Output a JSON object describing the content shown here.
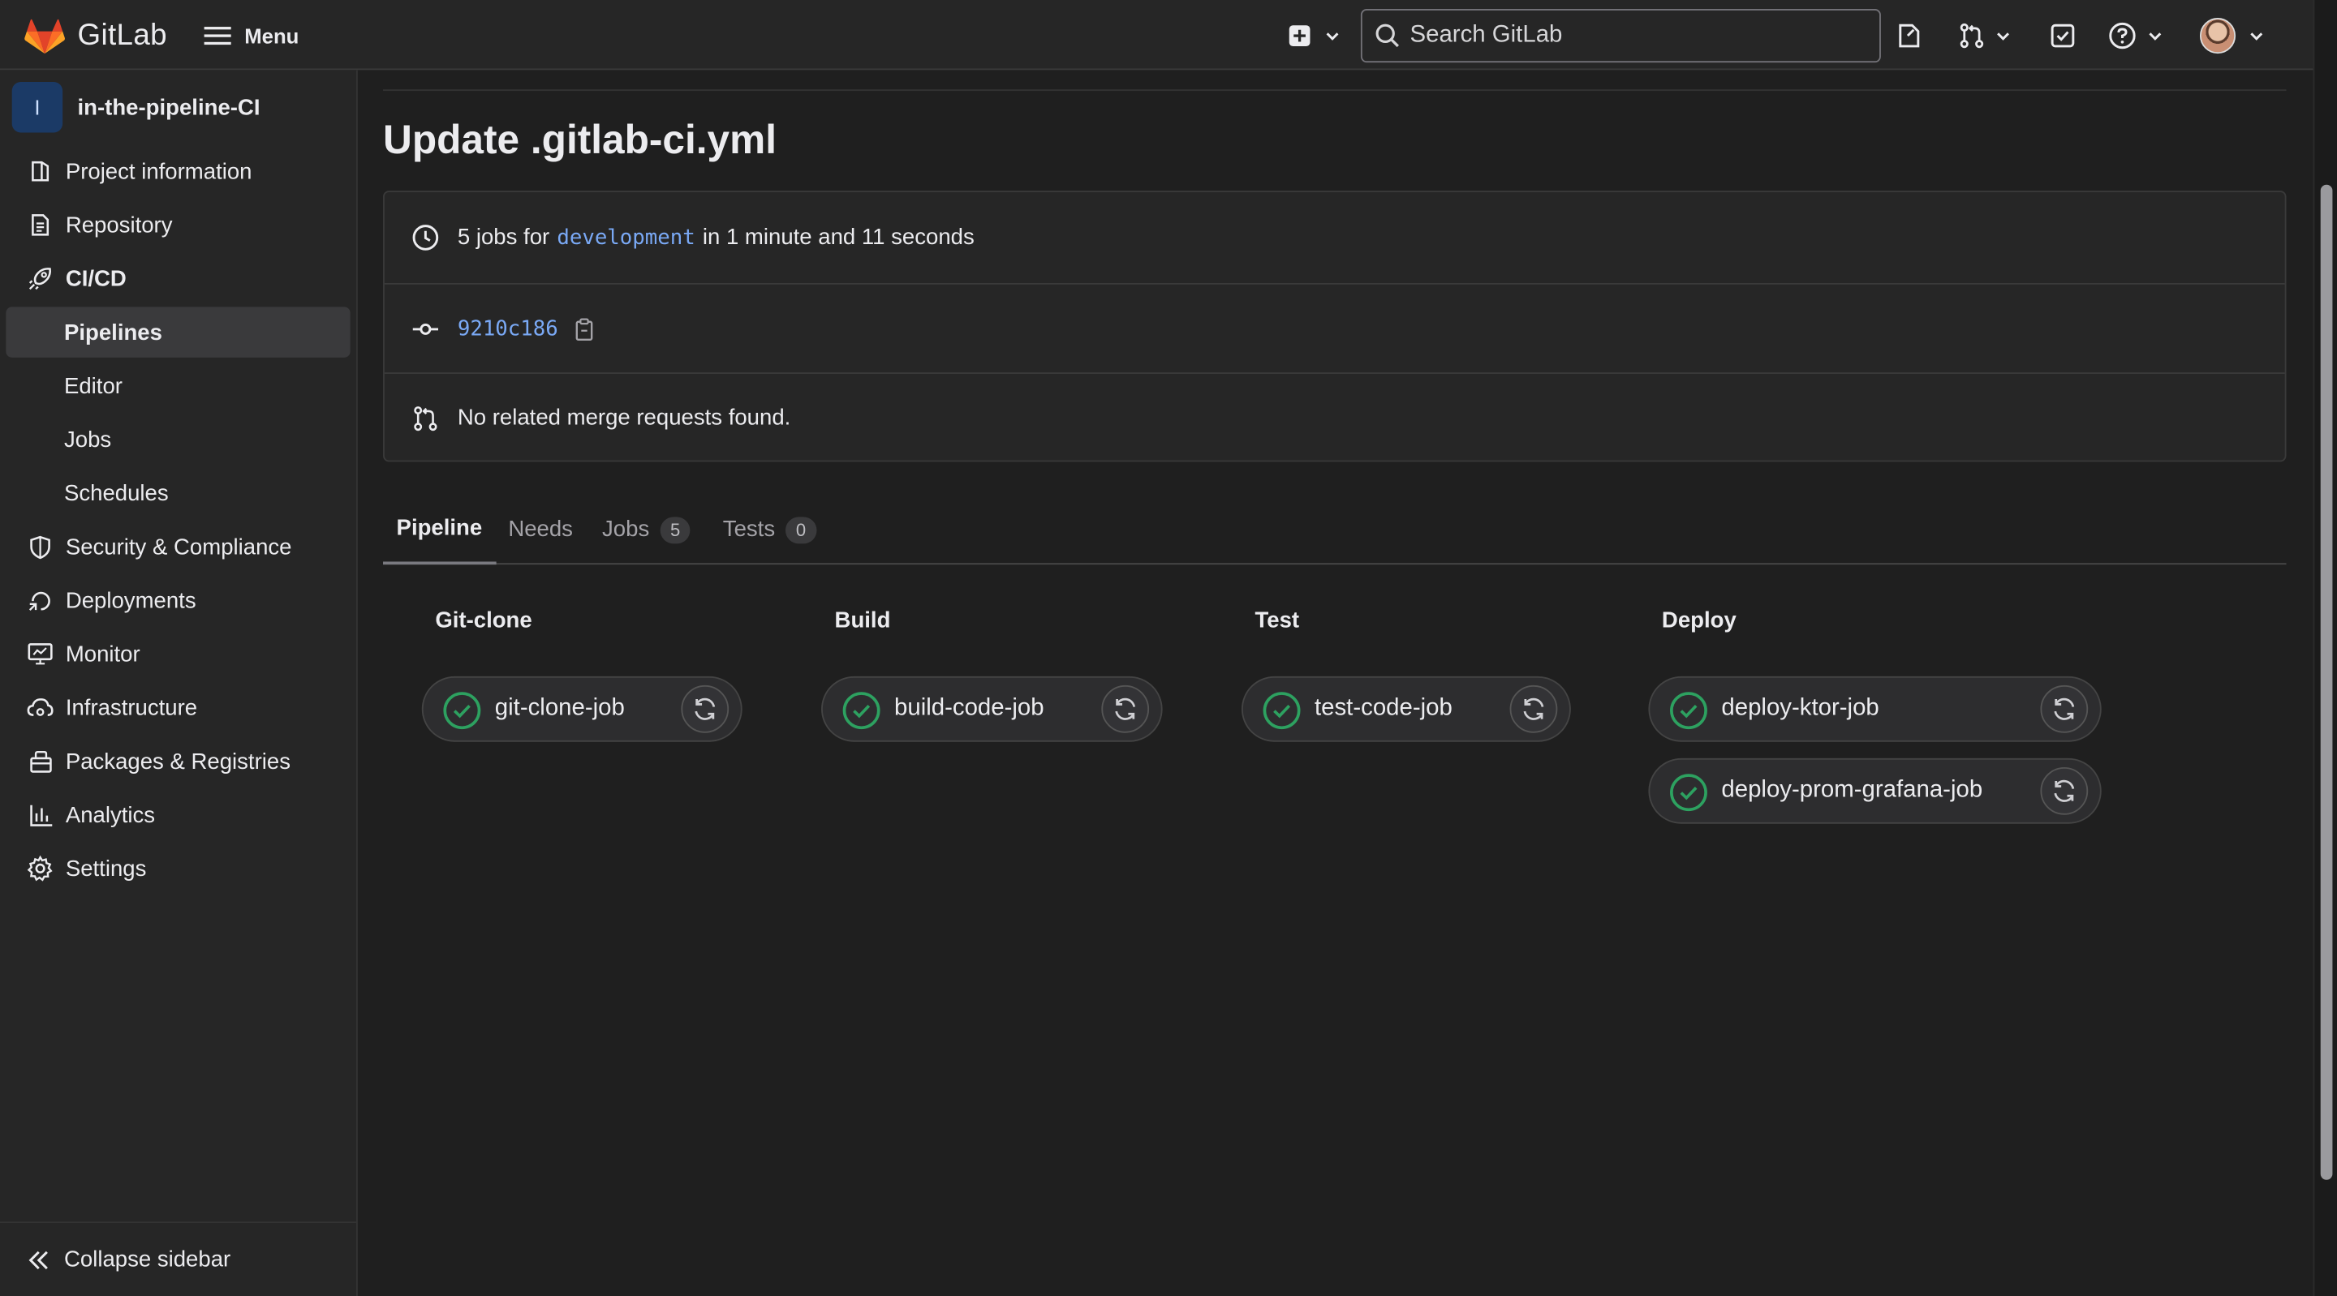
{
  "topbar": {
    "brand": "GitLab",
    "menu_label": "Menu",
    "search_placeholder": "Search GitLab"
  },
  "sidebar": {
    "project_initial": "I",
    "project_name": "in-the-pipeline-CI",
    "items": [
      {
        "label": "Project information",
        "icon": "project-info-icon"
      },
      {
        "label": "Repository",
        "icon": "repository-icon"
      },
      {
        "label": "CI/CD",
        "icon": "rocket-icon"
      },
      {
        "label": "Pipelines"
      },
      {
        "label": "Editor"
      },
      {
        "label": "Jobs"
      },
      {
        "label": "Schedules"
      },
      {
        "label": "Security & Compliance",
        "icon": "shield-icon"
      },
      {
        "label": "Deployments",
        "icon": "deployments-icon"
      },
      {
        "label": "Monitor",
        "icon": "monitor-icon"
      },
      {
        "label": "Infrastructure",
        "icon": "cloud-gear-icon"
      },
      {
        "label": "Packages & Registries",
        "icon": "package-icon"
      },
      {
        "label": "Analytics",
        "icon": "analytics-icon"
      },
      {
        "label": "Settings",
        "icon": "gear-icon"
      }
    ],
    "collapse_label": "Collapse sidebar"
  },
  "page": {
    "title": "Update .gitlab-ci.yml",
    "jobs_prefix": "5 jobs for",
    "branch": "development",
    "duration": "in 1 minute and 11 seconds",
    "commit_sha": "9210c186",
    "merge_requests": "No related merge requests found."
  },
  "tabs": [
    {
      "label": "Pipeline"
    },
    {
      "label": "Needs"
    },
    {
      "label": "Jobs",
      "count": "5"
    },
    {
      "label": "Tests",
      "count": "0"
    }
  ],
  "stages": [
    {
      "name": "Git-clone",
      "jobs": [
        "git-clone-job"
      ]
    },
    {
      "name": "Build",
      "jobs": [
        "build-code-job"
      ]
    },
    {
      "name": "Test",
      "jobs": [
        "test-code-job"
      ]
    },
    {
      "name": "Deploy",
      "jobs": [
        "deploy-ktor-job",
        "deploy-prom-grafana-job"
      ]
    }
  ],
  "colors": {
    "success": "#2da160",
    "link": "#7aa9f5",
    "brand_orange": "#e24329"
  }
}
